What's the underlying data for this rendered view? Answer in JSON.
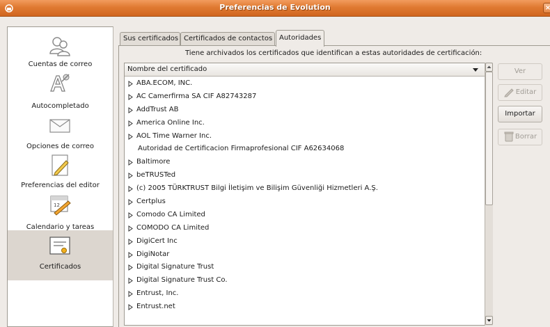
{
  "window": {
    "title": "Preferencias de Evolution",
    "close_glyph": "×",
    "accent_color": "#e07a32"
  },
  "sidebar": {
    "items": [
      {
        "label": "Cuentas de correo",
        "icon": "accounts-icon"
      },
      {
        "label": "Autocompletado",
        "icon": "autocomplete-icon"
      },
      {
        "label": "Opciones de correo",
        "icon": "mail-envelope-icon"
      },
      {
        "label": "Preferencias del editor",
        "icon": "editor-pencil-icon"
      },
      {
        "label": "Calendario y tareas",
        "icon": "calendar-icon"
      },
      {
        "label": "Certificados",
        "icon": "certificate-icon",
        "selected": true
      }
    ]
  },
  "tabs": [
    {
      "label": "Sus certificados"
    },
    {
      "label": "Certificados de contactos"
    },
    {
      "label": "Autoridades",
      "active": true
    }
  ],
  "info_text": "Tiene archivados los certificados que identifican a estas autoridades de certificación:",
  "list": {
    "column_header": "Nombre del certificado",
    "rows": [
      {
        "label": "ABA.ECOM, INC.",
        "expandable": true
      },
      {
        "label": "AC Camerfirma SA CIF A82743287",
        "expandable": true
      },
      {
        "label": "AddTrust AB",
        "expandable": true
      },
      {
        "label": "America Online Inc.",
        "expandable": true
      },
      {
        "label": "AOL Time Warner Inc.",
        "expandable": true
      },
      {
        "label": "Autoridad de Certificacion Firmaprofesional CIF A62634068",
        "expandable": false
      },
      {
        "label": "Baltimore",
        "expandable": true
      },
      {
        "label": "beTRUSTed",
        "expandable": true
      },
      {
        "label": "(c) 2005 TÜRKTRUST Bilgi İletişim ve Bilişim Güvenliği Hizmetleri A.Ş.",
        "expandable": true
      },
      {
        "label": "Certplus",
        "expandable": true
      },
      {
        "label": "Comodo CA Limited",
        "expandable": true
      },
      {
        "label": "COMODO CA Limited",
        "expandable": true
      },
      {
        "label": "DigiCert Inc",
        "expandable": true
      },
      {
        "label": "DigiNotar",
        "expandable": true
      },
      {
        "label": "Digital Signature Trust",
        "expandable": true
      },
      {
        "label": "Digital Signature Trust Co.",
        "expandable": true
      },
      {
        "label": "Entrust, Inc.",
        "expandable": true
      },
      {
        "label": "Entrust.net",
        "expandable": true
      }
    ]
  },
  "buttons": {
    "ver": "Ver",
    "editar": "Editar",
    "importar": "Importar",
    "borrar": "Borrar"
  }
}
